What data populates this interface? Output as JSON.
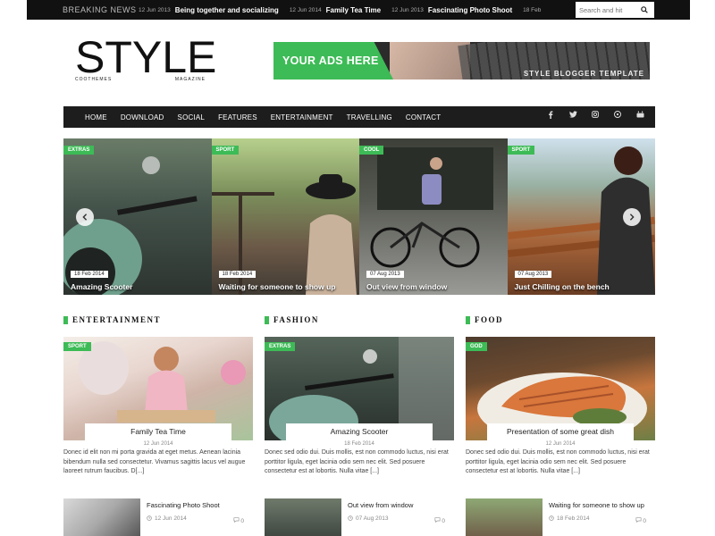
{
  "topbar": {
    "label": "Breaking News",
    "ticker": [
      {
        "date": "12 Jun 2013",
        "title": "Being together and socializing"
      },
      {
        "date": "12 Jun 2014",
        "title": "Family Tea Time"
      },
      {
        "date": "12 Jun 2013",
        "title": "Fascinating Photo Shoot"
      },
      {
        "date": "18 Feb"
      }
    ],
    "search_placeholder": "Search and hit"
  },
  "logo": {
    "word": "STYLE",
    "left_sub": "COOTHEMES",
    "right_sub": "MAGAZINE"
  },
  "ad": {
    "text": "YOUR ADS HERE",
    "tag": "STYLE BLOGGER TEMPLATE"
  },
  "nav": {
    "items": [
      "HOME",
      "DOWNLOAD",
      "SOCIAL",
      "FEATURES",
      "ENTERTAINMENT",
      "TRAVELLING",
      "CONTACT"
    ],
    "social": [
      "f",
      "t",
      "ig",
      "p",
      "yt"
    ]
  },
  "slider": [
    {
      "tag": "EXTRAS",
      "date": "18 Feb 2014",
      "title": "Amazing Scooter"
    },
    {
      "tag": "SPORT",
      "date": "18 Feb 2014",
      "title": "Waiting for someone to show up"
    },
    {
      "tag": "COOL",
      "date": "07 Aug 2013",
      "title": "Out view from window"
    },
    {
      "tag": "SPORT",
      "date": "07 Aug 2013",
      "title": "Just Chilling on the bench"
    }
  ],
  "sections": [
    {
      "heading": "ENTERTAINMENT",
      "tag": "SPORT",
      "title": "Family Tea Time",
      "date": "12 Jun 2014",
      "excerpt": "Donec id elit non mi porta gravida at eget metus. Aenean lacinia bibendum nulla sed consectetur. Vivamus sagittis lacus vel augue laoreet rutrum faucibus. D[...]",
      "mini": {
        "title": "Fascinating Photo Shoot",
        "date": "12 Jun 2014",
        "comments": "0"
      }
    },
    {
      "heading": "FASHION",
      "tag": "EXTRAS",
      "title": "Amazing Scooter",
      "date": "18 Feb 2014",
      "excerpt": "Donec sed odio dui. Duis mollis, est non commodo luctus, nisi erat porttitor ligula, eget lacinia odio sem nec elit. Sed posuere consectetur est at lobortis. Nulla vitae [...]",
      "mini": {
        "title": "Out view from window",
        "date": "07 Aug 2013",
        "comments": "0"
      }
    },
    {
      "heading": "FOOD",
      "tag": "GOD",
      "title": "Presentation of some great dish",
      "date": "12 Jun 2014",
      "excerpt": "Donec sed odio dui. Duis mollis, est non commodo luctus, nisi erat porttitor ligula, eget lacinia odio sem nec elit. Sed posuere consectetur est at lobortis. Nulla vitae [...]",
      "mini": {
        "title": "Waiting for someone to show up",
        "date": "18 Feb 2014",
        "comments": "0"
      }
    }
  ],
  "colors": {
    "accent": "#3dbb56",
    "dark": "#1d1d1d"
  }
}
